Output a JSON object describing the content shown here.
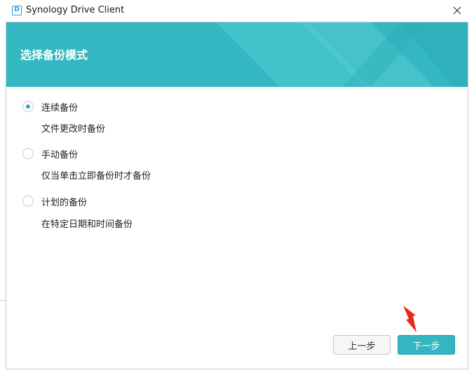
{
  "window": {
    "title": "Synology Drive Client",
    "logo_text": "D"
  },
  "banner": {
    "title": "选择备份模式",
    "color": "#33b7c1"
  },
  "options": [
    {
      "label": "连续备份",
      "description": "文件更改时备份",
      "selected": true
    },
    {
      "label": "手动备份",
      "description": "仅当单击立即备份时才备份",
      "selected": false
    },
    {
      "label": "计划的备份",
      "description": "在特定日期和时间备份",
      "selected": false
    }
  ],
  "buttons": {
    "prev_label": "上一步",
    "next_label": "下一步"
  },
  "colors": {
    "accent": "#33b5c2",
    "annotation_arrow": "#e8281e"
  }
}
